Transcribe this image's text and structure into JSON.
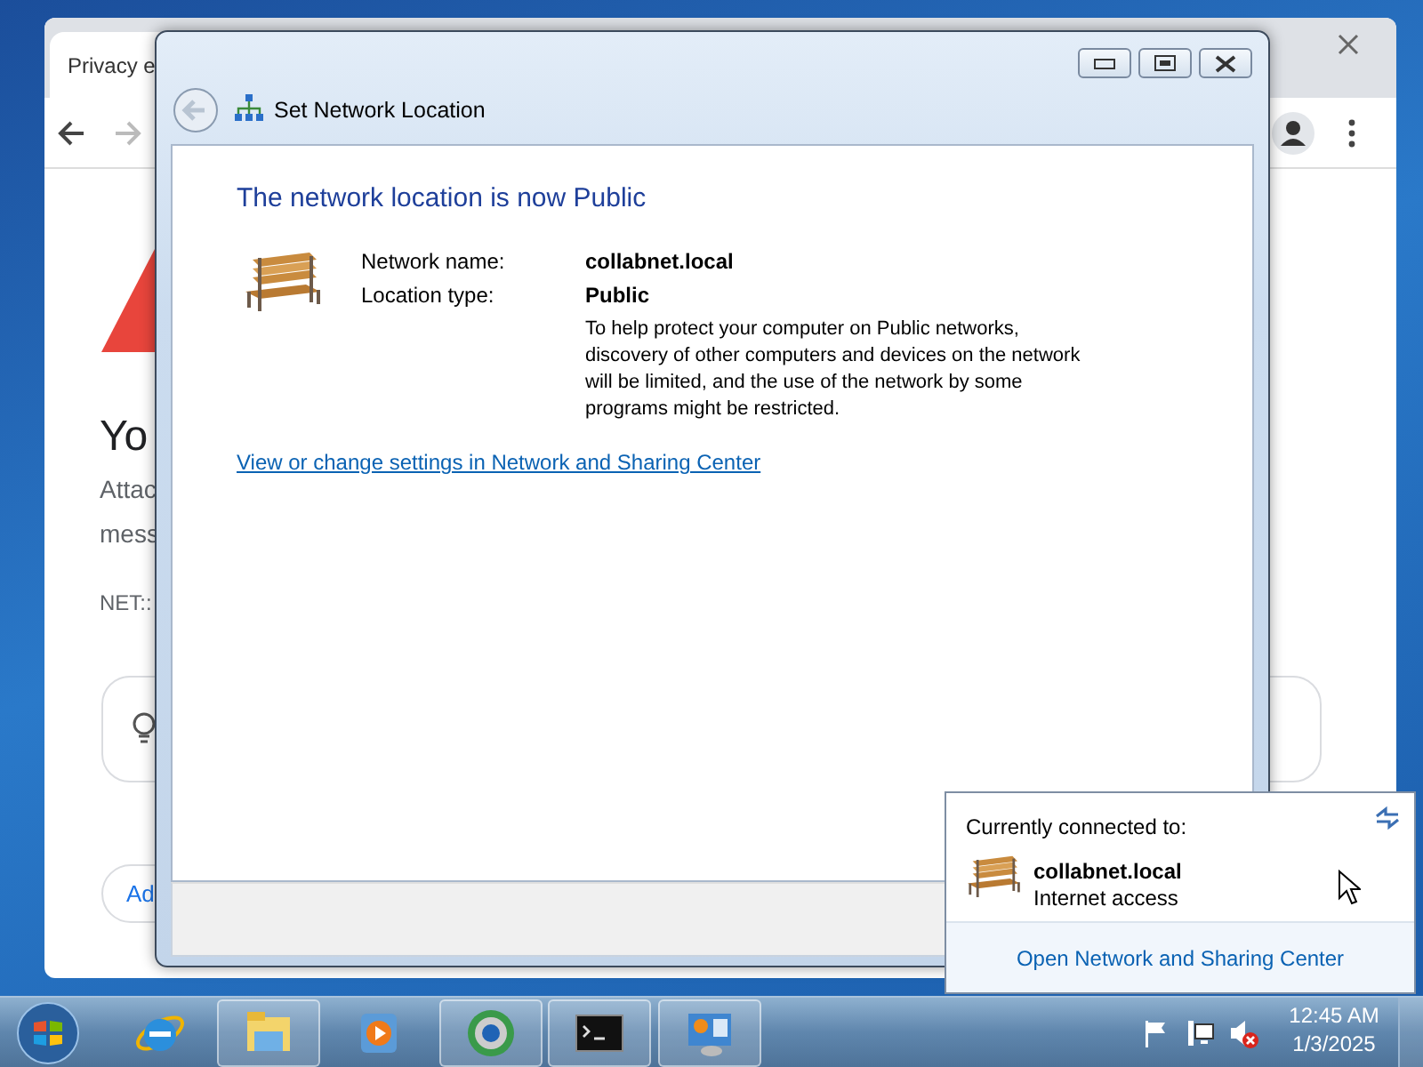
{
  "browser": {
    "tab_title": "Privacy e",
    "heading": "Yo",
    "lines": [
      "Attac",
      "mess"
    ],
    "error_code": "NET::",
    "button": "Ad"
  },
  "dialog": {
    "title": "Set Network Location",
    "heading": "The network location is now Public",
    "fields": [
      {
        "label": "Network name:",
        "value": "collabnet.local"
      },
      {
        "label": "Location type:",
        "value": "Public"
      }
    ],
    "description": "To help protect your computer on Public networks, discovery of other computers and devices on the network will be limited, and the use of the network by some programs might be restricted.",
    "link": "View or change settings in Network and Sharing Center"
  },
  "network_flyout": {
    "header": "Currently connected to:",
    "network_name": "collabnet.local",
    "status": "Internet access",
    "link": "Open Network and Sharing Center"
  },
  "taskbar": {
    "clock_time": "12:45 AM",
    "clock_date": "1/3/2025"
  }
}
